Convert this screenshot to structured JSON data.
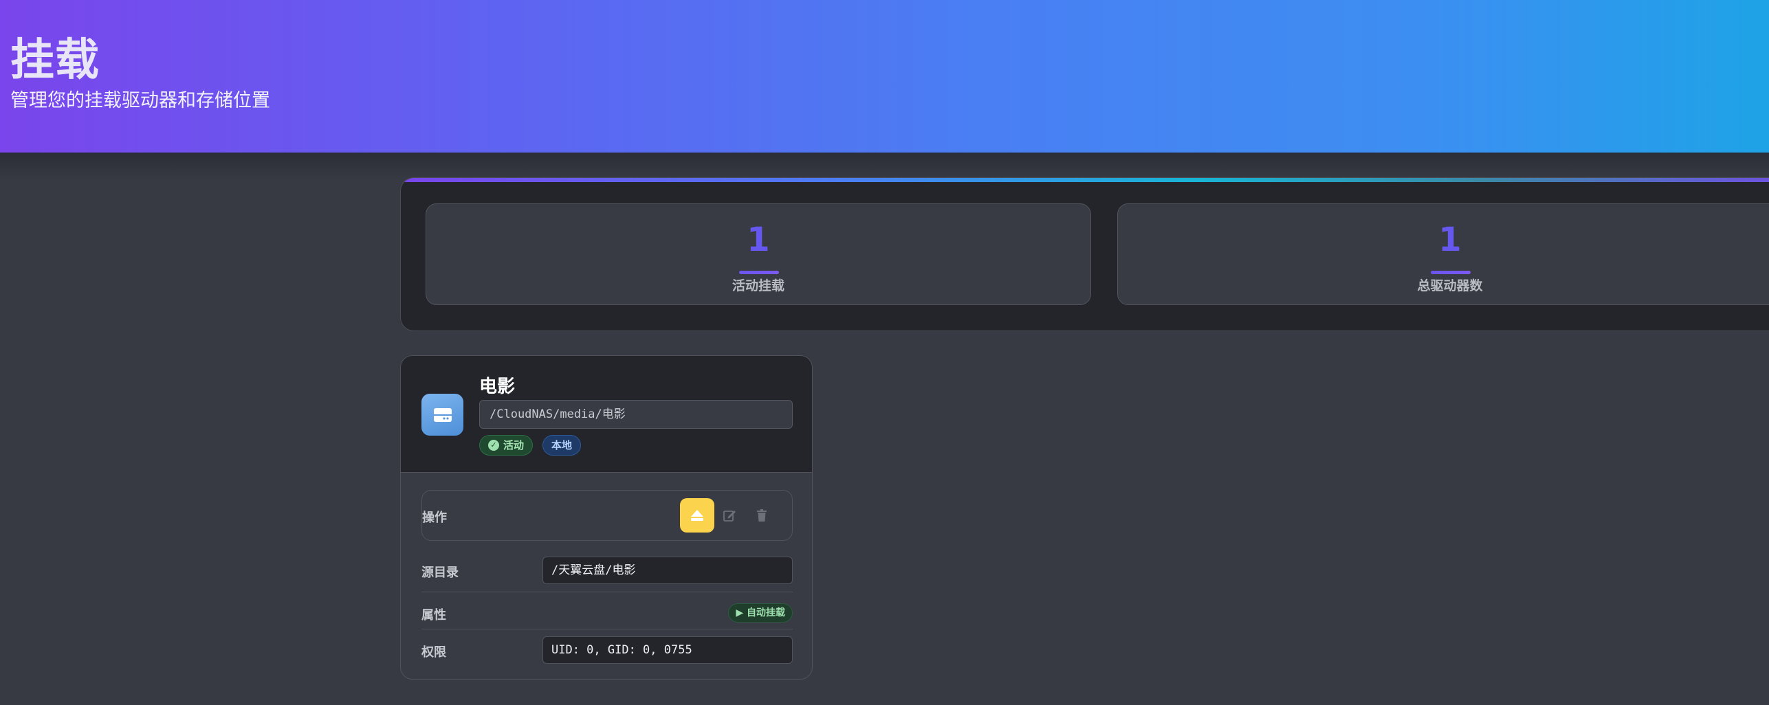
{
  "header": {
    "title": "挂载",
    "subtitle": "管理您的挂载驱动器和存储位置"
  },
  "stats": [
    {
      "value": "1",
      "label": "活动挂载"
    },
    {
      "value": "1",
      "label": "总驱动器数"
    }
  ],
  "mount": {
    "name": "电影",
    "path": "/CloudNAS/media/电影",
    "status_badge": "活动",
    "type_badge": "本地",
    "actions_label": "操作",
    "source_label": "源目录",
    "source_value": "/天翼云盘/电影",
    "props_label": "属性",
    "props_badge": "自动挂载",
    "perm_label": "权限",
    "perm_value": "UID: 0, GID: 0, 0755"
  },
  "icons": {
    "drive": "hard-drive-icon",
    "status": "check-circle-icon",
    "eject": "eject-icon",
    "edit": "edit-icon",
    "delete": "trash-icon",
    "play": "play-icon"
  },
  "colors": {
    "accent": "#6657ee",
    "eject": "#fcd34d",
    "active": "#a8e6b5",
    "local": "#b6d2ff"
  }
}
